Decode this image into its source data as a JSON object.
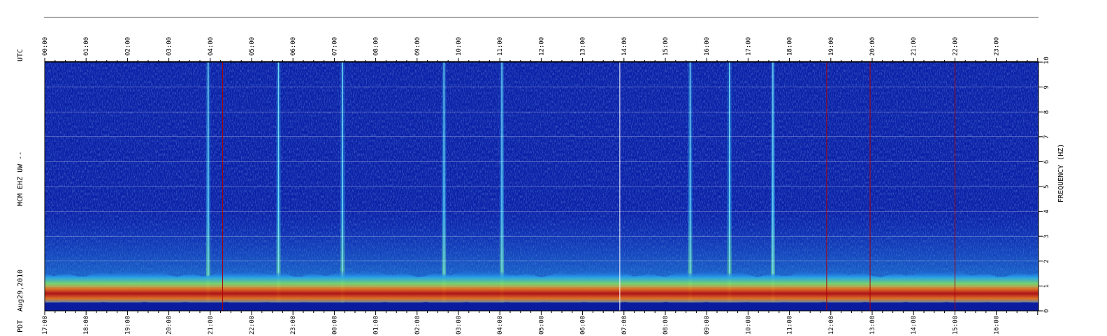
{
  "station_label": "MCM EHZ UW --",
  "top_axis_label": "UTC",
  "bottom_axis_label": "PDT",
  "date_label": "Aug29,2010",
  "chart_data": {
    "type": "heatmap",
    "title": "",
    "ylabel": "FREQUENCY (HZ)",
    "ylim": [
      0,
      10
    ],
    "grid": true,
    "yticks": [
      "0",
      "1",
      "2",
      "3",
      "4",
      "5",
      "6",
      "7",
      "8",
      "9",
      "10"
    ],
    "utc_ticks": [
      "00:00",
      "01:00",
      "02:00",
      "03:00",
      "04:00",
      "05:00",
      "06:00",
      "07:00",
      "08:00",
      "09:00",
      "10:00",
      "11:00",
      "12:00",
      "13:00",
      "14:00",
      "15:00",
      "16:00",
      "17:00",
      "18:00",
      "19:00",
      "20:00",
      "21:00",
      "22:00",
      "23:00"
    ],
    "pdt_ticks": [
      "17:00",
      "18:00",
      "19:00",
      "20:00",
      "21:00",
      "22:00",
      "23:00",
      "00:00",
      "01:00",
      "02:00",
      "03:00",
      "04:00",
      "05:00",
      "06:00",
      "07:00",
      "08:00",
      "09:00",
      "10:00",
      "11:00",
      "12:00",
      "13:00",
      "14:00",
      "15:00",
      "16:00"
    ],
    "colormap": [
      "#0a1b9e",
      "#1e56d8",
      "#2aa5e8",
      "#7ddc6a",
      "#f5e43a",
      "#e8731e",
      "#b51212"
    ],
    "gap_band_color": "#0a1b9e",
    "marker_colors": {
      "red": "#b00000",
      "white": "#ffffff",
      "cyan": "#7ff0ff"
    },
    "utc_hours": [
      0,
      24
    ],
    "low_frequency_energy_band_hz": [
      0.3,
      1.5
    ],
    "broadband_event_utc_hours": [
      3.95,
      5.65,
      7.2,
      9.65,
      11.05,
      15.6,
      16.55,
      17.6
    ],
    "red_marker_utc_hours": [
      4.3,
      18.9,
      19.95,
      22.0
    ]
  }
}
